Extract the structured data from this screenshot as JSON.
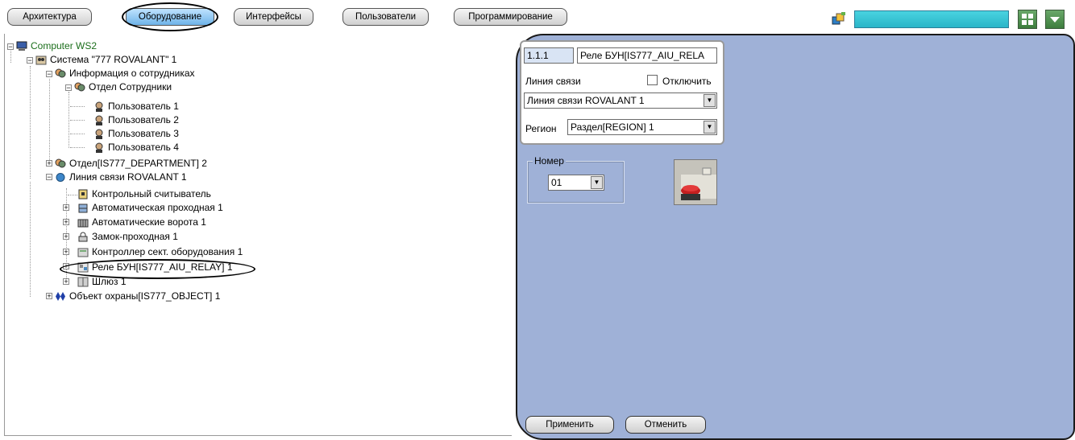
{
  "toolbar": {
    "tabs": [
      {
        "label": "Архитектура"
      },
      {
        "label": "Оборудование"
      },
      {
        "label": "Интерфейсы"
      },
      {
        "label": "Пользователи"
      },
      {
        "label": "Программирование"
      }
    ],
    "active_tab": "Оборудование"
  },
  "tree": {
    "items": [
      {
        "label": "Computer WS2",
        "icon": "computer-icon"
      },
      {
        "label": "Система \"777 ROVALANT\" 1",
        "icon": "system-icon"
      },
      {
        "label": "Информация о сотрудниках",
        "icon": "employees-info-icon"
      },
      {
        "label": "Отдел Сотрудники",
        "icon": "department-icon"
      },
      {
        "label": "Пользователь 1",
        "icon": "user-icon"
      },
      {
        "label": "Пользователь 2",
        "icon": "user-icon"
      },
      {
        "label": "Пользователь 3",
        "icon": "user-icon"
      },
      {
        "label": "Пользователь 4",
        "icon": "user-icon"
      },
      {
        "label": "Отдел[IS777_DEPARTMENT] 2",
        "icon": "department-icon"
      },
      {
        "label": "Линия связи ROVALANT 1",
        "icon": "comm-line-icon"
      },
      {
        "label": "Контрольный считыватель",
        "icon": "reader-icon"
      },
      {
        "label": "Автоматическая проходная 1",
        "icon": "turnstile-icon"
      },
      {
        "label": "Автоматические ворота 1",
        "icon": "gate-icon"
      },
      {
        "label": "Замок-проходная 1",
        "icon": "lock-icon"
      },
      {
        "label": "Контроллер сект. оборудования 1",
        "icon": "controller-icon"
      },
      {
        "label": "Реле БУН[IS777_AIU_RELAY] 1",
        "icon": "relay-icon"
      },
      {
        "label": "Шлюз 1",
        "icon": "gateway-icon"
      },
      {
        "label": "Объект охраны[IS777_OBJECT] 1",
        "icon": "guard-object-icon"
      }
    ]
  },
  "settings": {
    "id_value": "1.1.1",
    "name_value": "Реле БУН[IS777_AIU_RELA",
    "comm_line_label": "Линия связи",
    "disable_label": "Отключить",
    "disable_checked": false,
    "comm_line_value": "Линия связи ROVALANT 1",
    "region_label": "Регион",
    "region_value": "Раздел[REGION] 1",
    "number_group_label": "Номер",
    "number_value": "01",
    "apply_label": "Применить",
    "cancel_label": "Отменить"
  },
  "colors": {
    "settings_bg": "#9fb1d7",
    "active_tab": "#6fb3e8",
    "search_box": "#2ab5c8"
  }
}
